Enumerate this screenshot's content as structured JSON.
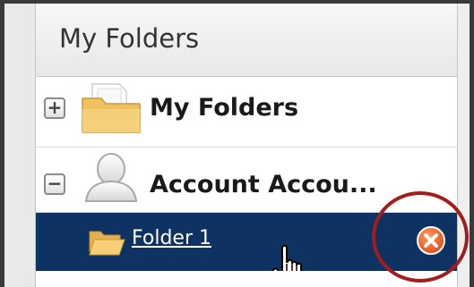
{
  "panel": {
    "title": "My Folders"
  },
  "tree": {
    "items": [
      {
        "toggle": "+",
        "label": "My Folders",
        "icon": "folder-icon",
        "state": "collapsed"
      },
      {
        "toggle": "−",
        "label": "Account Accou...",
        "icon": "user-icon",
        "state": "expanded"
      },
      {
        "label": "Folder 1",
        "icon": "open-folder-icon",
        "selected": true,
        "action_icon": "delete-icon"
      }
    ]
  },
  "colors": {
    "selected_row": "#0e3262",
    "folder": "#f3c86a",
    "delete_button": "#ee5a24",
    "highlight_ring": "#a31d1d"
  }
}
